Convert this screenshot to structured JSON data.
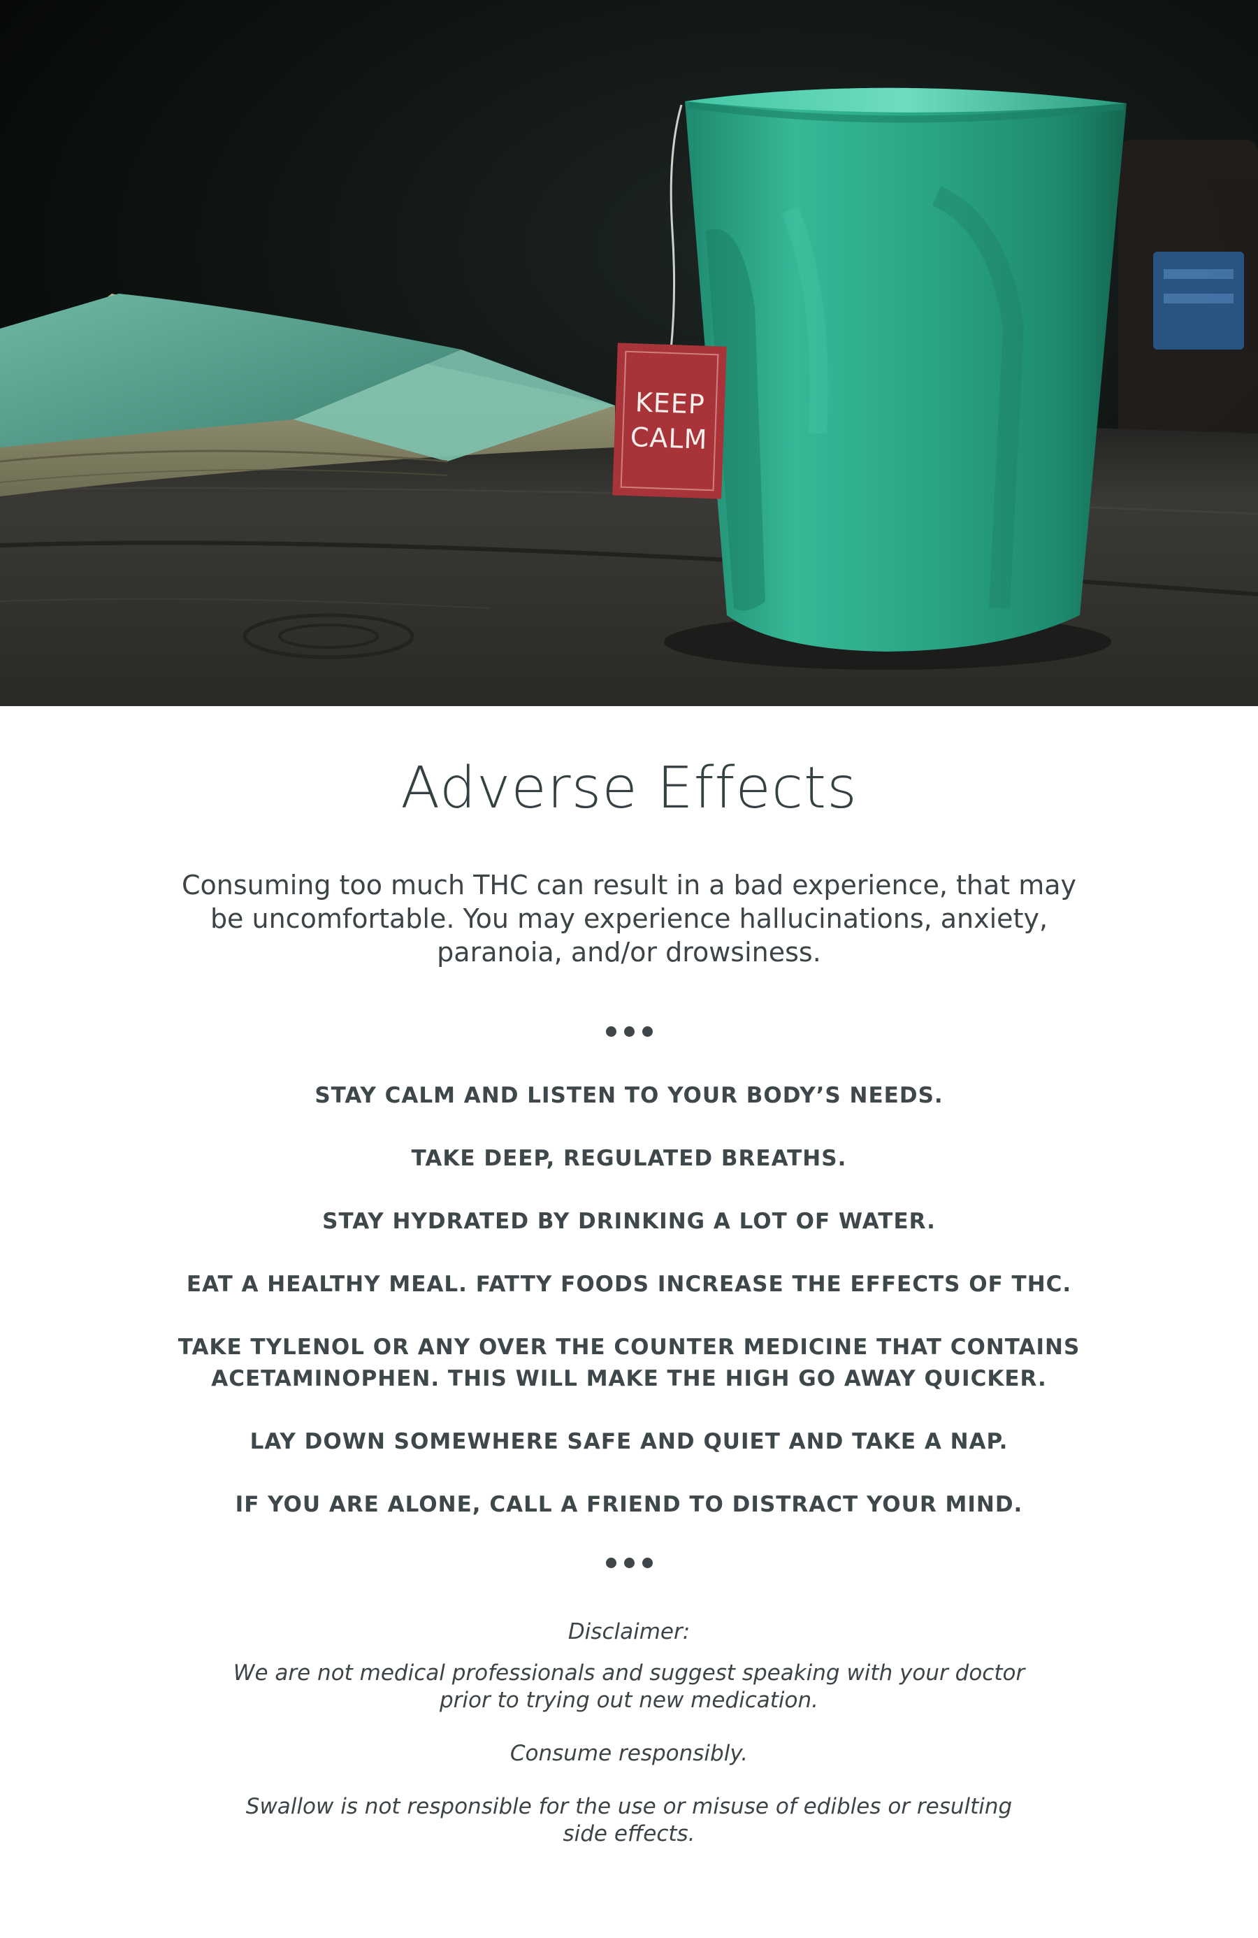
{
  "hero": {
    "tag_text_line1": "KEEP",
    "tag_text_line2": "CALM",
    "colors": {
      "mug": "#2fb092",
      "tag": "#a8343a",
      "table": "#2c2a27",
      "book": "#5da796",
      "background": "#0c100f"
    }
  },
  "title": "Adverse Effects",
  "intro": "Consuming too much THC can result in a bad experience, that may be uncomfortable. You may experience hallucinations, anxiety, paranoia, and/or drowsiness.",
  "tips": [
    "STAY CALM AND LISTEN TO YOUR BODY’S NEEDS.",
    "TAKE DEEP, REGULATED BREATHS.",
    "STAY HYDRATED BY DRINKING A LOT OF WATER.",
    "EAT A HEALTHY MEAL. FATTY FOODS INCREASE THE EFFECTS OF THC.",
    "TAKE TYLENOL OR ANY OVER THE COUNTER MEDICINE THAT CONTAINS\nACETAMINOPHEN. THIS WILL MAKE THE HIGH GO AWAY QUICKER.",
    "LAY DOWN SOMEWHERE SAFE AND QUIET AND TAKE A NAP.",
    "IF YOU ARE ALONE, CALL A FRIEND TO DISTRACT YOUR MIND."
  ],
  "disclaimer": {
    "heading": "Disclaimer:",
    "medical": "We are not medical professionals and suggest speaking with your doctor\nprior to trying out new medication.",
    "responsibly": "Consume responsibly.",
    "liability": "Swallow is not responsible for the use or misuse of edibles or resulting\nside effects."
  }
}
